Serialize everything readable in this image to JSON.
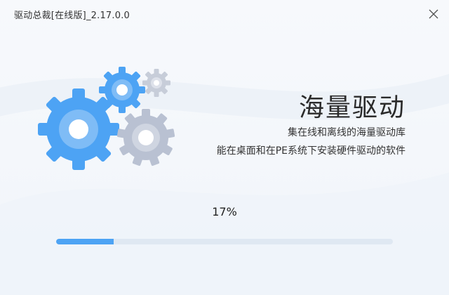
{
  "window": {
    "title": "驱动总裁[在线版]_2.17.0.0"
  },
  "icons": {
    "close": "close-icon",
    "gears": "gears-illustration"
  },
  "hero": {
    "heading": "海量驱动",
    "line1": "集在线和离线的海量驱动库",
    "line2": "能在桌面和在PE系统下安装硬件驱动的软件"
  },
  "progress": {
    "percent_label": "17%",
    "value": 0.17
  },
  "colors": {
    "accent": "#4da3f4",
    "track": "#dfe8f2",
    "gear_blue": "#4da3f4",
    "gear_gray": "#b9c1d2"
  }
}
